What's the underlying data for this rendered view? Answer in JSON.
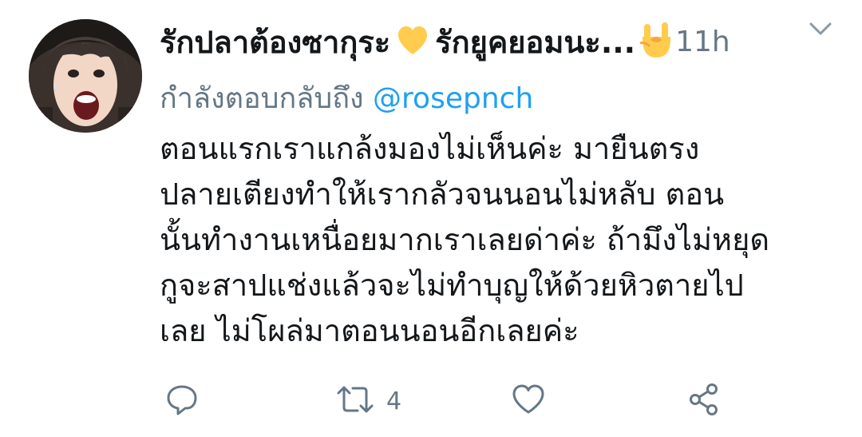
{
  "tweet": {
    "display_name_part1": "รักปลาต้องซากุระ",
    "display_name_part2": "รักยูคยอมนะ...",
    "heart_icon": "yellow-heart-icon",
    "hand_icon": "sign-of-horns-icon",
    "timestamp": "11h",
    "reply_prefix": "กำลังตอบกลับถึง",
    "reply_mention": "@rosepnch",
    "body_lines": [
      "ตอนแรกเราแกล้งมองไม่เห็นค่ะ มายืนตรง",
      "ปลายเตียงทำให้เรากลัวจนนอนไม่หลับ ตอน",
      "นั้นทำงานเหนื่อยมากเราเลยด่าค่ะ ถ้ามึงไม่หยุด",
      "กูจะสาปแช่งแล้วจะไม่ทำบุญให้ด้วยหิวตายไป",
      "เลย ไม่โผล่มาตอนนอนอีกเลยค่ะ"
    ],
    "actions": {
      "reply_icon": "reply-icon",
      "retweet_icon": "retweet-icon",
      "retweet_count": "4",
      "like_icon": "like-icon",
      "share_icon": "share-icon"
    },
    "colors": {
      "text": "#14171a",
      "secondary": "#657786",
      "link": "#1da1f2",
      "heart": "#ffcc4d"
    }
  }
}
